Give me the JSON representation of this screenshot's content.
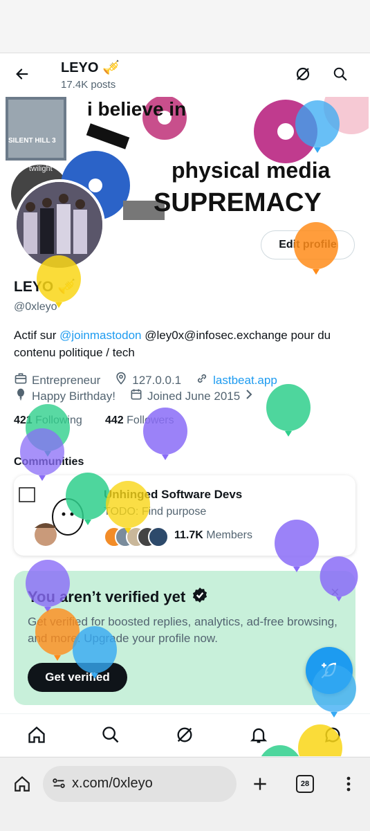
{
  "header": {
    "title": "LEYO",
    "posts": "17.4K posts"
  },
  "banner": {
    "line1": "i believe in",
    "line2": "physical media",
    "line3": "SUPREMACY",
    "cover_label": "SILENT HILL 3",
    "dvd_label": "twilight"
  },
  "profile": {
    "edit_label": "Edit profile",
    "name": "LEYO",
    "handle": "@0xleyo",
    "bio_prefix": "Actif sur ",
    "bio_mention": "@joinmastodon",
    "bio_suffix": " @ley0x@infosec.exchange pour du contenu politique / tech",
    "profession": "Entrepreneur",
    "location": "127.0.0.1",
    "website": "lastbeat.app",
    "birthday": "Happy Birthday!",
    "joined": "Joined June 2015",
    "following_count": "421",
    "following_label": "Following",
    "followers_count": "442",
    "followers_label": "Followers"
  },
  "communities": {
    "title": "Communities",
    "card": {
      "name": "Unhinged Software Devs",
      "tagline": "TODO: Find purpose",
      "members_count": "11.7K",
      "members_label": "Members"
    }
  },
  "verify": {
    "title": "You aren’t verified yet",
    "body": "Get verified for boosted replies, analytics, ad-free browsing, and more. Upgrade your profile now.",
    "button": "Get verified",
    "close": "×"
  },
  "browser": {
    "url": "x.com/0xleyo",
    "tab_count": "28"
  },
  "colors": {
    "accent": "#1d9bf0",
    "verify_bg": "#c8f0da",
    "text": "#0f1419",
    "muted": "#536471"
  }
}
